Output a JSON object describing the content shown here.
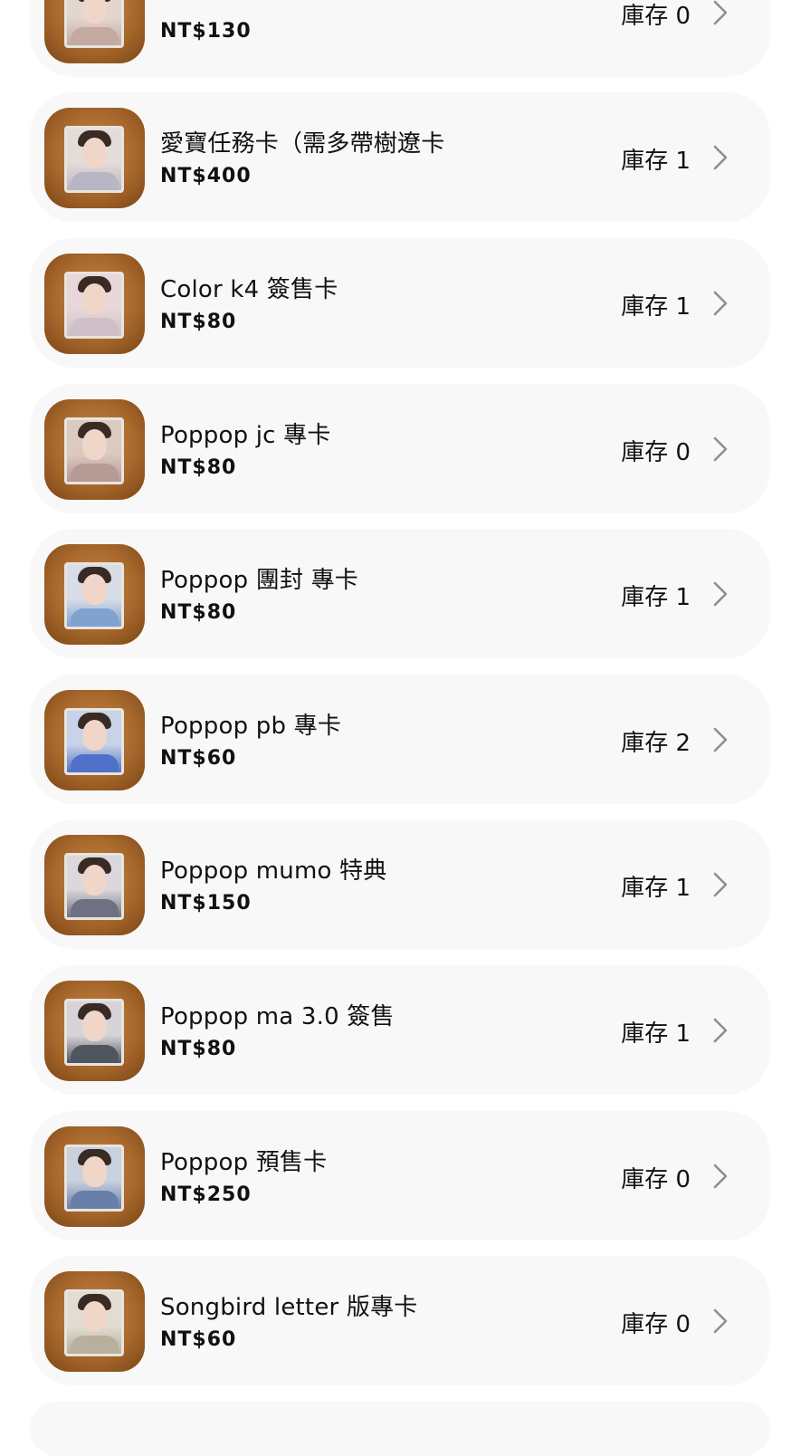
{
  "products": [
    {
      "name": "",
      "price": "NT$130",
      "stock": "庫存 0",
      "tones": [
        "#e3d6cf",
        "#c4a9a1"
      ]
    },
    {
      "name": "愛寶任務卡（需多帶樹遼卡",
      "price": "NT$400",
      "stock": "庫存 1",
      "tones": [
        "#e4dcd8",
        "#b8b6c4"
      ]
    },
    {
      "name": "Color k4 簽售卡",
      "price": "NT$80",
      "stock": "庫存 1",
      "tones": [
        "#e8d6d8",
        "#cfc0c8"
      ]
    },
    {
      "name": "Poppop jc 專卡",
      "price": "NT$80",
      "stock": "庫存 0",
      "tones": [
        "#dcc9c0",
        "#b59a96"
      ]
    },
    {
      "name": "Poppop 團封 專卡",
      "price": "NT$80",
      "stock": "庫存 1",
      "tones": [
        "#d8dce6",
        "#7fa2cf"
      ]
    },
    {
      "name": "Poppop pb 專卡",
      "price": "NT$60",
      "stock": "庫存 2",
      "tones": [
        "#c8d2e8",
        "#4f72c8"
      ]
    },
    {
      "name": "Poppop mumo 特典",
      "price": "NT$150",
      "stock": "庫存 1",
      "tones": [
        "#dad8dc",
        "#6e7280"
      ]
    },
    {
      "name": "Poppop ma 3.0 簽售",
      "price": "NT$80",
      "stock": "庫存 1",
      "tones": [
        "#d6d4d8",
        "#505660"
      ]
    },
    {
      "name": "Poppop 預售卡",
      "price": "NT$250",
      "stock": "庫存 0",
      "tones": [
        "#c9d0de",
        "#6a7fa8"
      ]
    },
    {
      "name": "Songbird letter 版專卡",
      "price": "NT$60",
      "stock": "庫存 0",
      "tones": [
        "#e2ddd2",
        "#b8b09c"
      ]
    }
  ],
  "icons": {
    "chevron": "chevron-right-icon"
  }
}
